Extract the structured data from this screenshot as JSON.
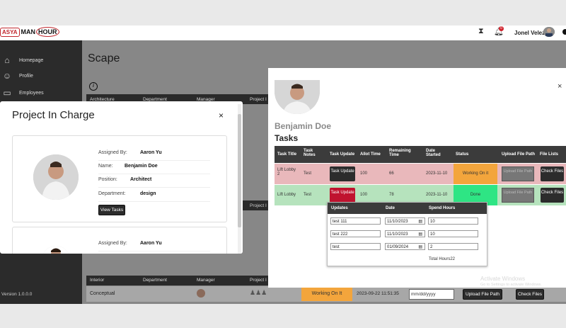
{
  "brand": {
    "part1": "ASYA",
    "part2": "MAN",
    "part3": "HOUR"
  },
  "header": {
    "user_name": "Jonel Velez",
    "notification_count": "0",
    "icons": [
      "hourglass-icon",
      "bell-icon"
    ]
  },
  "sidebar": {
    "items": [
      {
        "label": "Homepage",
        "icon": "home-icon"
      },
      {
        "label": "Profile",
        "icon": "profile-icon"
      },
      {
        "label": "Employees",
        "icon": "briefcase-icon"
      }
    ],
    "version": "Version 1.0.0.0"
  },
  "page": {
    "title": "Scape",
    "table_headers": [
      "Architecture",
      "Department",
      "Manager",
      "Project I"
    ],
    "bottom_headers": [
      "Interior",
      "Department",
      "Manager",
      "Project I"
    ],
    "bottom_row": {
      "col1": "Conceptual",
      "status": "Working On It",
      "timestamp": "2023-09-22 11:51:35",
      "date_placeholder": "mm/dd/yyyy",
      "upload_label": "Upload File Path",
      "check_label": "Check Files"
    }
  },
  "project_modal": {
    "title": "Project In Charge",
    "close": "×",
    "cards": [
      {
        "assigned_by_label": "Assigned By:",
        "assigned_by": "Aaron Yu",
        "name_label": "Name:",
        "name": "Benjamin Doe",
        "position_label": "Position:",
        "position": "Architect",
        "department_label": "Department:",
        "department": "design",
        "view_label": "View Tasks"
      },
      {
        "assigned_by_label": "Assigned By:",
        "assigned_by": "Aaron Yu"
      }
    ]
  },
  "tasks_modal": {
    "close": "×",
    "name": "Benjamin Doe",
    "heading": "Tasks",
    "headers": [
      "Task Title",
      "Task Notes",
      "Task Update",
      "Allot Time",
      "Remaining Time",
      "Date Started",
      "Status",
      "Upload File Path",
      "File Lists"
    ],
    "rows": [
      {
        "title": "Lift Lobby 2",
        "notes": "Test",
        "update": "Task Update",
        "allot": "100",
        "remaining": "66",
        "date": "2023-11-10",
        "status": "Working On it",
        "upload": "Upload File Path",
        "files": "Check Files"
      },
      {
        "title": "Lift Lobby",
        "notes": "Test",
        "update": "Task Update",
        "allot": "100",
        "remaining": "78",
        "date": "2023-11-10",
        "status": "Done",
        "upload": "Upload File Path",
        "files": "Check Files"
      }
    ],
    "updates_popup": {
      "headers": [
        "Updates",
        "Date",
        "Spend Hours"
      ],
      "rows": [
        {
          "update": "test 111",
          "date": "11/10/2023",
          "hours": "10"
        },
        {
          "update": "test 222",
          "date": "11/10/2023",
          "hours": "10"
        },
        {
          "update": "test",
          "date": "01/09/2024",
          "hours": "2"
        }
      ],
      "total": "Total Hours22"
    }
  },
  "watermark": {
    "line1": "Activate Windows",
    "line2": "Go to Settings to activate Windows."
  }
}
